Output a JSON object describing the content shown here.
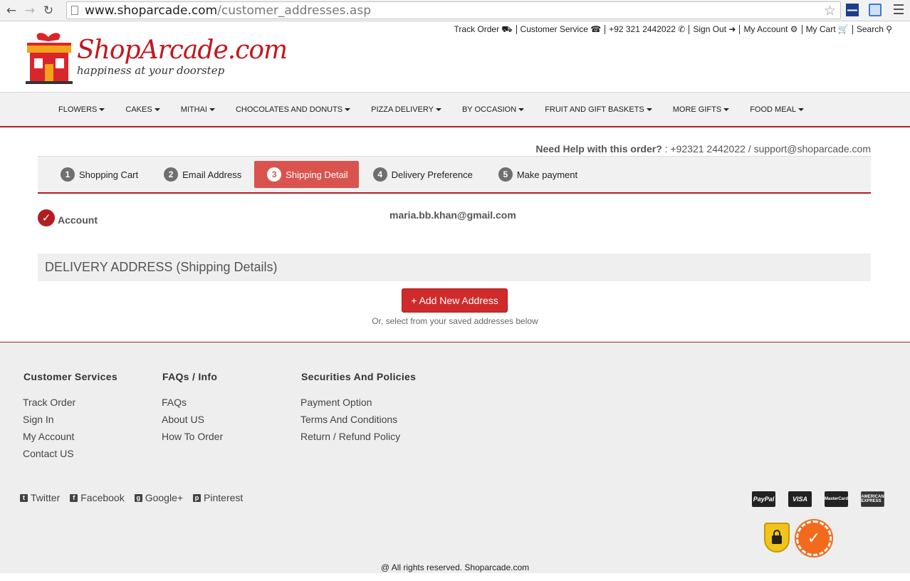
{
  "browser": {
    "url_host": "www.shoparcade.com",
    "url_path": "/customer_addresses.asp"
  },
  "top_links": [
    "Track Order",
    "Customer Service",
    "+92 321 2442022",
    "Sign Out",
    "My Account",
    "My Cart",
    "Search"
  ],
  "logo": {
    "name": "ShopArcade.com",
    "tagline": "happiness at your doorstep"
  },
  "nav": [
    "FLOWERS",
    "CAKES",
    "MITHAI",
    "CHOCOLATES AND DONUTS",
    "PIZZA DELIVERY",
    "BY OCCASION",
    "FRUIT AND GIFT BASKETS",
    "MORE GIFTS",
    "FOOD MEAL"
  ],
  "help": {
    "label": "Need Help with this order?",
    "contact": " : +92321 2442022 / support@shoparcade.com"
  },
  "steps": [
    {
      "num": "1",
      "label": "Shopping Cart"
    },
    {
      "num": "2",
      "label": "Email Address"
    },
    {
      "num": "3",
      "label": "Shipping Detail"
    },
    {
      "num": "4",
      "label": "Delivery Preference"
    },
    {
      "num": "5",
      "label": "Make payment"
    }
  ],
  "account": {
    "label": "Account",
    "email": "maria.bb.khan@gmail.com"
  },
  "delivery": {
    "title": "DELIVERY ADDRESS (Shipping Details)",
    "add_button": "+ Add New Address",
    "note": "Or, select from your saved addresses below"
  },
  "footer": {
    "col1": {
      "title": "Customer Services",
      "links": [
        "Track Order",
        "Sign In",
        "My Account",
        "Contact US"
      ]
    },
    "col2": {
      "title": "FAQs / Info",
      "links": [
        "FAQs",
        "About US",
        "How To Order"
      ]
    },
    "col3": {
      "title": "Securities And Policies",
      "links": [
        "Payment Option",
        "Terms And Conditions",
        "Return / Refund Policy"
      ]
    },
    "social": [
      "Twitter",
      "Facebook",
      "Google+",
      "Pinterest"
    ],
    "cards": [
      "PayPal",
      "VISA",
      "MasterCard",
      "AMERICAN EXPRESS"
    ],
    "copyright": "@ All rights reserved. Shoparcade.com"
  },
  "colors": {
    "brand_red": "#b01e23",
    "active_step": "#d9534f",
    "button_red": "#cf2b2b"
  }
}
